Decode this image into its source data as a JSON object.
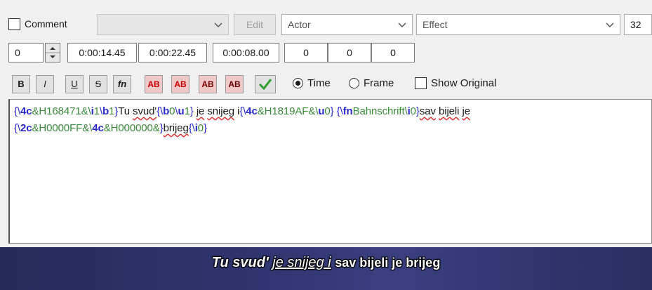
{
  "toolbar1": {
    "comment_label": "Comment",
    "style_value": "",
    "edit_label": "Edit",
    "actor_placeholder": "Actor",
    "effect_placeholder": "Effect",
    "margin_value": "32"
  },
  "toolbar2": {
    "layer_value": "0",
    "start_time": "0:00:14.45",
    "end_time": "0:00:22.45",
    "duration": "0:00:08.00",
    "margin_left": "0",
    "margin_right": "0",
    "margin_vertical": "0"
  },
  "toolbar3": {
    "bold": "B",
    "italic": "I",
    "underline": "U",
    "strike": "S",
    "font": "fn",
    "color1": "AB",
    "color2": "AB",
    "color3": "AB",
    "color4": "AB",
    "time_label": "Time",
    "frame_label": "Frame",
    "show_original_label": "Show Original"
  },
  "editor": {
    "line1": [
      {
        "t": "{\\",
        "c": "ovb"
      },
      {
        "t": "4c",
        "c": "tag"
      },
      {
        "t": "&H168471&\\",
        "c": "num"
      },
      {
        "t": "i",
        "c": "tag"
      },
      {
        "t": "1",
        "c": "num"
      },
      {
        "t": "\\",
        "c": "ovb"
      },
      {
        "t": "b",
        "c": "tag"
      },
      {
        "t": "1",
        "c": "num"
      },
      {
        "t": "}",
        "c": "ovb"
      },
      {
        "t": "Tu ",
        "c": ""
      },
      {
        "t": "svud'",
        "c": "txt-sq"
      },
      {
        "t": "{\\",
        "c": "ovb"
      },
      {
        "t": "b",
        "c": "tag"
      },
      {
        "t": "0",
        "c": "num"
      },
      {
        "t": "\\",
        "c": "ovb"
      },
      {
        "t": "u",
        "c": "tag"
      },
      {
        "t": "1",
        "c": "num"
      },
      {
        "t": "} ",
        "c": "ovb"
      },
      {
        "t": "je",
        "c": "txt-sq"
      },
      {
        "t": " ",
        "c": ""
      },
      {
        "t": "snijeg",
        "c": "txt-sq"
      },
      {
        "t": " i",
        "c": ""
      },
      {
        "t": "{\\",
        "c": "ovb"
      },
      {
        "t": "4c",
        "c": "tag"
      },
      {
        "t": "&H1819AF&\\",
        "c": "num"
      },
      {
        "t": "u",
        "c": "tag"
      },
      {
        "t": "0",
        "c": "num"
      },
      {
        "t": "} ",
        "c": "ovb"
      },
      {
        "t": "{\\",
        "c": "ovb"
      },
      {
        "t": "fn",
        "c": "tag"
      },
      {
        "t": "Bahnschrift\\",
        "c": "num"
      },
      {
        "t": "i",
        "c": "tag"
      },
      {
        "t": "0",
        "c": "num"
      },
      {
        "t": "}",
        "c": "ovb"
      },
      {
        "t": "sav",
        "c": "txt-sq"
      },
      {
        "t": " ",
        "c": ""
      },
      {
        "t": "bijeli",
        "c": "txt-sq"
      },
      {
        "t": " ",
        "c": ""
      },
      {
        "t": "je",
        "c": "txt-sq"
      }
    ],
    "line2": [
      {
        "t": "{\\",
        "c": "ovb"
      },
      {
        "t": "2c",
        "c": "tag"
      },
      {
        "t": "&H0000FF&\\",
        "c": "num"
      },
      {
        "t": "4c",
        "c": "tag"
      },
      {
        "t": "&H000000&",
        "c": "num"
      },
      {
        "t": "}",
        "c": "ovb"
      },
      {
        "t": "brijeg",
        "c": "txt-sq"
      },
      {
        "t": "{\\",
        "c": "ovb"
      },
      {
        "t": "i",
        "c": "tag"
      },
      {
        "t": "0",
        "c": "num"
      },
      {
        "t": "}",
        "c": "ovb"
      }
    ]
  },
  "video": {
    "subtitle_part1": "Tu svud'",
    "subtitle_part2": "je snijeg i",
    "subtitle_part3": "sav bijeli je brijeg"
  },
  "colors": {
    "override_blue": "#2a2acf",
    "value_green": "#3a8a3a",
    "confirm_green": "#2e9e2e"
  }
}
